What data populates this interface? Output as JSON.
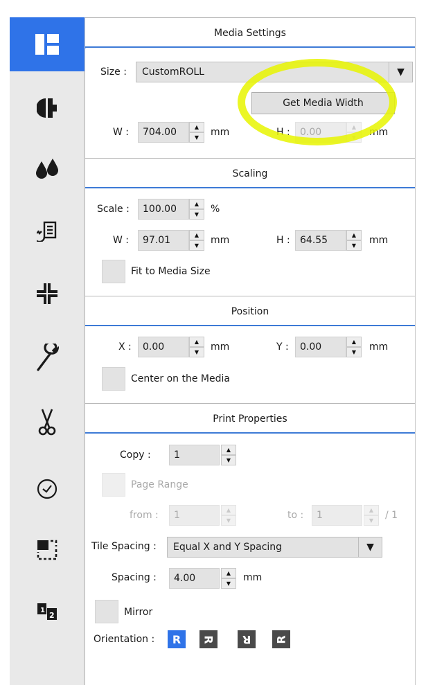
{
  "colors": {
    "accent": "#2f73e8",
    "highlight": "#e8f500",
    "sidebar_bg": "#e9e9e9"
  },
  "sidebar": {
    "items": [
      {
        "icon": "layout-icon",
        "active": true
      },
      {
        "icon": "color-icon",
        "active": false
      },
      {
        "icon": "ink-drops-icon",
        "active": false
      },
      {
        "icon": "queue-refresh-icon",
        "active": false
      },
      {
        "icon": "crop-marks-icon",
        "active": false
      },
      {
        "icon": "wrench-icon",
        "active": false
      },
      {
        "icon": "scissors-icon",
        "active": false
      },
      {
        "icon": "clock-icon",
        "active": false
      },
      {
        "icon": "selection-icon",
        "active": false
      },
      {
        "icon": "pages-1-2-icon",
        "active": false
      }
    ]
  },
  "media": {
    "title": "Media Settings",
    "size_label": "Size :",
    "size_value": "CustomROLL",
    "get_width_button": "Get Media Width",
    "w_label": "W :",
    "w_value": "704.00",
    "w_unit": "mm",
    "h_label": "H :",
    "h_value": "0.00",
    "h_unit": "mm"
  },
  "scaling": {
    "title": "Scaling",
    "scale_label": "Scale :",
    "scale_value": "100.00",
    "scale_unit": "%",
    "w_label": "W :",
    "w_value": "97.01",
    "w_unit": "mm",
    "h_label": "H :",
    "h_value": "64.55",
    "h_unit": "mm",
    "fit_label": "Fit to Media Size"
  },
  "position": {
    "title": "Position",
    "x_label": "X :",
    "x_value": "0.00",
    "x_unit": "mm",
    "y_label": "Y :",
    "y_value": "0.00",
    "y_unit": "mm",
    "center_label": "Center on the Media"
  },
  "print": {
    "title": "Print Properties",
    "copy_label": "Copy :",
    "copy_value": "1",
    "page_range_label": "Page Range",
    "from_label": "from :",
    "from_value": "1",
    "to_label": "to :",
    "to_value": "1",
    "total_pages": "/ 1",
    "tile_label": "Tile Spacing :",
    "tile_value": "Equal X and Y Spacing",
    "spacing_label": "Spacing :",
    "spacing_value": "4.00",
    "spacing_unit": "mm",
    "mirror_label": "Mirror",
    "orientation_label": "Orientation :",
    "orientation_glyph": "R"
  }
}
